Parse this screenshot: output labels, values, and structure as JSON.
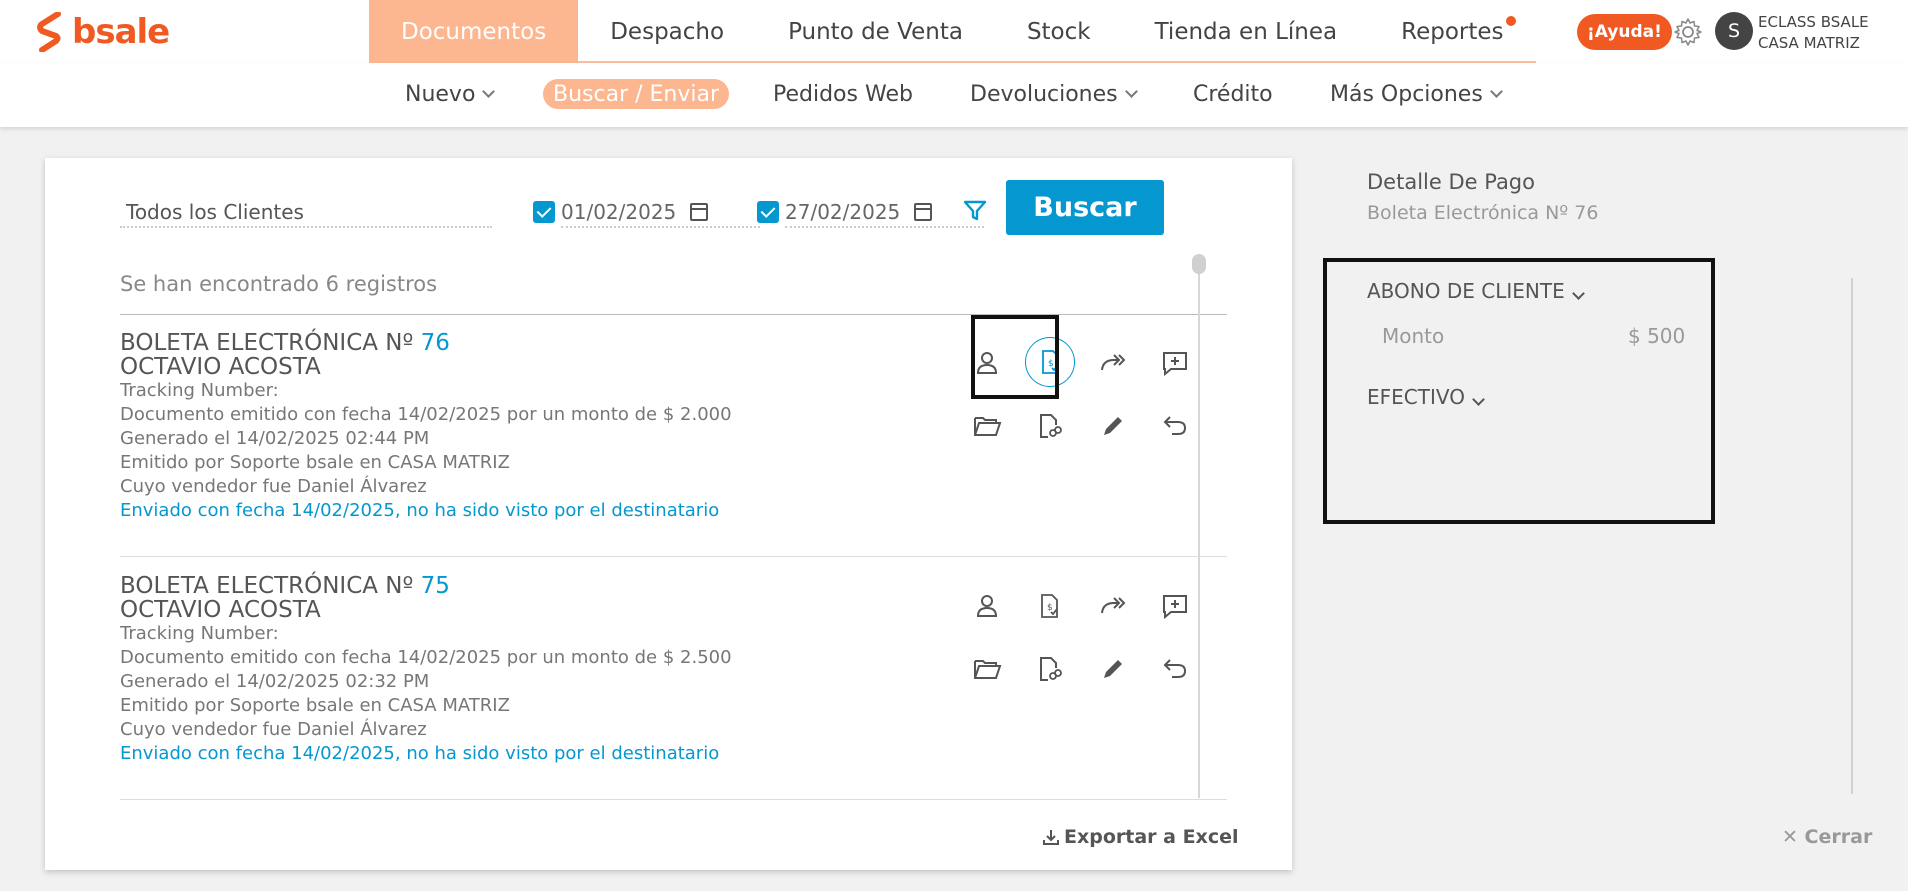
{
  "brand": {
    "name": "bsale",
    "color": "#f05a22"
  },
  "main_nav": {
    "items": [
      {
        "label": "Documentos",
        "active": true
      },
      {
        "label": "Despacho"
      },
      {
        "label": "Punto de Venta"
      },
      {
        "label": "Stock"
      },
      {
        "label": "Tienda en Línea"
      },
      {
        "label": "Reportes",
        "notification_dot": true
      }
    ],
    "help_label": "¡Ayuda!",
    "settings_icon": "gear-icon",
    "avatar_initial": "S",
    "company_line1": "ECLASS BSALE",
    "company_line2": "CASA MATRIZ"
  },
  "sub_nav": {
    "items": [
      {
        "label": "Nuevo",
        "has_dropdown": true
      },
      {
        "label": "Buscar / Enviar",
        "active": true
      },
      {
        "label": "Pedidos Web"
      },
      {
        "label": "Devoluciones",
        "has_dropdown": true
      },
      {
        "label": "Crédito"
      },
      {
        "label": "Más Opciones",
        "has_dropdown": true
      }
    ]
  },
  "filters": {
    "client": "Todos los Clientes",
    "date_from": "01/02/2025",
    "date_from_checked": true,
    "date_to": "27/02/2025",
    "date_to_checked": true,
    "search_button": "Buscar"
  },
  "results_count_text": "Se han encontrado 6 registros",
  "documents": [
    {
      "title": "BOLETA ELECTRÓNICA Nº",
      "number": "76",
      "client": "OCTAVIO ACOSTA",
      "tracking": "Tracking Number:",
      "emitted": "Documento emitido con fecha 14/02/2025 por un monto de $ 2.000",
      "generated": "Generado el 14/02/2025 02:44 PM",
      "issued_by": "Emitido por Soporte bsale en CASA MATRIZ",
      "seller": "Cuyo vendedor fue Daniel Álvarez",
      "sent": "Enviado con fecha 14/02/2025, no ha sido visto por el destinatario"
    },
    {
      "title": "BOLETA ELECTRÓNICA Nº",
      "number": "75",
      "client": "OCTAVIO ACOSTA",
      "tracking": "Tracking Number:",
      "emitted": "Documento emitido con fecha 14/02/2025 por un monto de $ 2.500",
      "generated": "Generado el 14/02/2025 02:32 PM",
      "issued_by": "Emitido por Soporte bsale en CASA MATRIZ",
      "seller": "Cuyo vendedor fue Daniel Álvarez",
      "sent": "Enviado con fecha 14/02/2025, no ha sido visto por el destinatario"
    }
  ],
  "export_label": "Exportar a Excel",
  "payment_detail": {
    "title": "Detalle De Pago",
    "subtitle": "Boleta Electrónica Nº 76",
    "section1": "ABONO DE CLIENTE",
    "monto_label": "Monto",
    "monto_value": "$ 500",
    "section2": "EFECTIVO"
  },
  "close_label": "Cerrar",
  "colors": {
    "accent_blue": "#0497d0",
    "accent_orange": "#f05a22",
    "active_tab": "#fcb690"
  }
}
